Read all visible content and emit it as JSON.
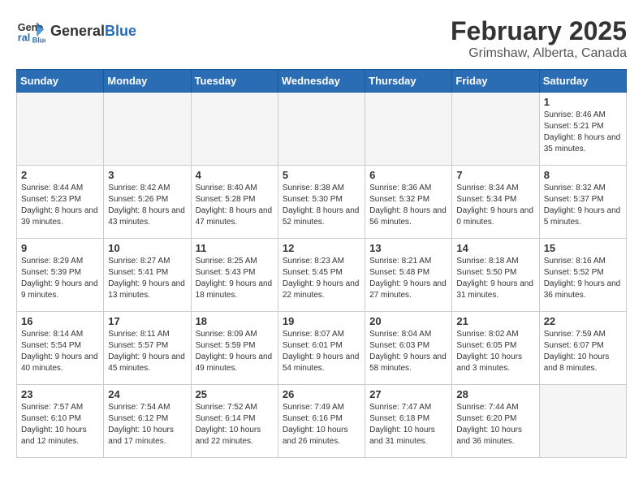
{
  "header": {
    "logo_general": "General",
    "logo_blue": "Blue",
    "title": "February 2025",
    "subtitle": "Grimshaw, Alberta, Canada"
  },
  "calendar": {
    "weekdays": [
      "Sunday",
      "Monday",
      "Tuesday",
      "Wednesday",
      "Thursday",
      "Friday",
      "Saturday"
    ],
    "weeks": [
      [
        {
          "day": "",
          "info": "",
          "empty": true
        },
        {
          "day": "",
          "info": "",
          "empty": true
        },
        {
          "day": "",
          "info": "",
          "empty": true
        },
        {
          "day": "",
          "info": "",
          "empty": true
        },
        {
          "day": "",
          "info": "",
          "empty": true
        },
        {
          "day": "",
          "info": "",
          "empty": true
        },
        {
          "day": "1",
          "info": "Sunrise: 8:46 AM\nSunset: 5:21 PM\nDaylight: 8 hours and 35 minutes."
        }
      ],
      [
        {
          "day": "2",
          "info": "Sunrise: 8:44 AM\nSunset: 5:23 PM\nDaylight: 8 hours and 39 minutes."
        },
        {
          "day": "3",
          "info": "Sunrise: 8:42 AM\nSunset: 5:26 PM\nDaylight: 8 hours and 43 minutes."
        },
        {
          "day": "4",
          "info": "Sunrise: 8:40 AM\nSunset: 5:28 PM\nDaylight: 8 hours and 47 minutes."
        },
        {
          "day": "5",
          "info": "Sunrise: 8:38 AM\nSunset: 5:30 PM\nDaylight: 8 hours and 52 minutes."
        },
        {
          "day": "6",
          "info": "Sunrise: 8:36 AM\nSunset: 5:32 PM\nDaylight: 8 hours and 56 minutes."
        },
        {
          "day": "7",
          "info": "Sunrise: 8:34 AM\nSunset: 5:34 PM\nDaylight: 9 hours and 0 minutes."
        },
        {
          "day": "8",
          "info": "Sunrise: 8:32 AM\nSunset: 5:37 PM\nDaylight: 9 hours and 5 minutes."
        }
      ],
      [
        {
          "day": "9",
          "info": "Sunrise: 8:29 AM\nSunset: 5:39 PM\nDaylight: 9 hours and 9 minutes."
        },
        {
          "day": "10",
          "info": "Sunrise: 8:27 AM\nSunset: 5:41 PM\nDaylight: 9 hours and 13 minutes."
        },
        {
          "day": "11",
          "info": "Sunrise: 8:25 AM\nSunset: 5:43 PM\nDaylight: 9 hours and 18 minutes."
        },
        {
          "day": "12",
          "info": "Sunrise: 8:23 AM\nSunset: 5:45 PM\nDaylight: 9 hours and 22 minutes."
        },
        {
          "day": "13",
          "info": "Sunrise: 8:21 AM\nSunset: 5:48 PM\nDaylight: 9 hours and 27 minutes."
        },
        {
          "day": "14",
          "info": "Sunrise: 8:18 AM\nSunset: 5:50 PM\nDaylight: 9 hours and 31 minutes."
        },
        {
          "day": "15",
          "info": "Sunrise: 8:16 AM\nSunset: 5:52 PM\nDaylight: 9 hours and 36 minutes."
        }
      ],
      [
        {
          "day": "16",
          "info": "Sunrise: 8:14 AM\nSunset: 5:54 PM\nDaylight: 9 hours and 40 minutes."
        },
        {
          "day": "17",
          "info": "Sunrise: 8:11 AM\nSunset: 5:57 PM\nDaylight: 9 hours and 45 minutes."
        },
        {
          "day": "18",
          "info": "Sunrise: 8:09 AM\nSunset: 5:59 PM\nDaylight: 9 hours and 49 minutes."
        },
        {
          "day": "19",
          "info": "Sunrise: 8:07 AM\nSunset: 6:01 PM\nDaylight: 9 hours and 54 minutes."
        },
        {
          "day": "20",
          "info": "Sunrise: 8:04 AM\nSunset: 6:03 PM\nDaylight: 9 hours and 58 minutes."
        },
        {
          "day": "21",
          "info": "Sunrise: 8:02 AM\nSunset: 6:05 PM\nDaylight: 10 hours and 3 minutes."
        },
        {
          "day": "22",
          "info": "Sunrise: 7:59 AM\nSunset: 6:07 PM\nDaylight: 10 hours and 8 minutes."
        }
      ],
      [
        {
          "day": "23",
          "info": "Sunrise: 7:57 AM\nSunset: 6:10 PM\nDaylight: 10 hours and 12 minutes."
        },
        {
          "day": "24",
          "info": "Sunrise: 7:54 AM\nSunset: 6:12 PM\nDaylight: 10 hours and 17 minutes."
        },
        {
          "day": "25",
          "info": "Sunrise: 7:52 AM\nSunset: 6:14 PM\nDaylight: 10 hours and 22 minutes."
        },
        {
          "day": "26",
          "info": "Sunrise: 7:49 AM\nSunset: 6:16 PM\nDaylight: 10 hours and 26 minutes."
        },
        {
          "day": "27",
          "info": "Sunrise: 7:47 AM\nSunset: 6:18 PM\nDaylight: 10 hours and 31 minutes."
        },
        {
          "day": "28",
          "info": "Sunrise: 7:44 AM\nSunset: 6:20 PM\nDaylight: 10 hours and 36 minutes."
        },
        {
          "day": "",
          "info": "",
          "empty": true
        }
      ]
    ]
  }
}
